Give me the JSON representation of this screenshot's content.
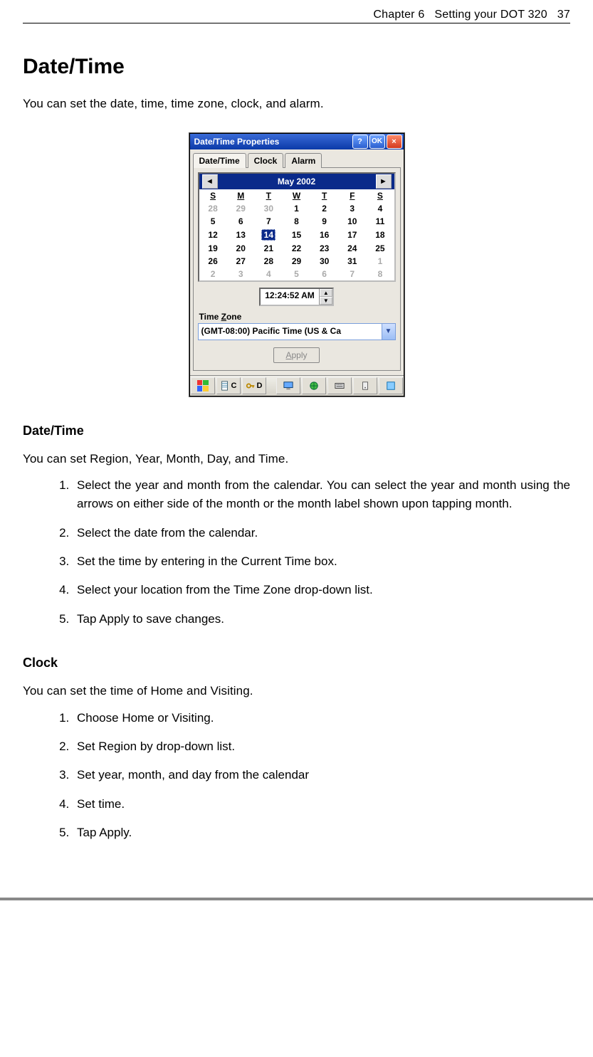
{
  "header": {
    "chapter": "Chapter 6",
    "title": "Setting your DOT 320",
    "page": "37"
  },
  "h1": "Date/Time",
  "intro": "You can set the date, time, time zone, clock, and alarm.",
  "dialog": {
    "title": "Date/Time Properties",
    "buttons": {
      "help": "?",
      "ok": "OK",
      "close": "×"
    },
    "tabs": [
      "Date/Time",
      "Clock",
      "Alarm"
    ],
    "calendar": {
      "month_label": "May 2002",
      "dow": [
        "S",
        "M",
        "T",
        "W",
        "T",
        "F",
        "S"
      ],
      "rows": [
        [
          {
            "d": "28",
            "dim": true
          },
          {
            "d": "29",
            "dim": true
          },
          {
            "d": "30",
            "dim": true
          },
          {
            "d": "1"
          },
          {
            "d": "2"
          },
          {
            "d": "3"
          },
          {
            "d": "4"
          }
        ],
        [
          {
            "d": "5"
          },
          {
            "d": "6"
          },
          {
            "d": "7"
          },
          {
            "d": "8"
          },
          {
            "d": "9"
          },
          {
            "d": "10"
          },
          {
            "d": "11"
          }
        ],
        [
          {
            "d": "12"
          },
          {
            "d": "13"
          },
          {
            "d": "14",
            "sel": true
          },
          {
            "d": "15"
          },
          {
            "d": "16"
          },
          {
            "d": "17"
          },
          {
            "d": "18"
          }
        ],
        [
          {
            "d": "19"
          },
          {
            "d": "20"
          },
          {
            "d": "21"
          },
          {
            "d": "22"
          },
          {
            "d": "23"
          },
          {
            "d": "24"
          },
          {
            "d": "25"
          }
        ],
        [
          {
            "d": "26"
          },
          {
            "d": "27"
          },
          {
            "d": "28"
          },
          {
            "d": "29"
          },
          {
            "d": "30"
          },
          {
            "d": "31"
          },
          {
            "d": "1",
            "dim": true
          }
        ],
        [
          {
            "d": "2",
            "dim": true
          },
          {
            "d": "3",
            "dim": true
          },
          {
            "d": "4",
            "dim": true
          },
          {
            "d": "5",
            "dim": true
          },
          {
            "d": "6",
            "dim": true
          },
          {
            "d": "7",
            "dim": true
          },
          {
            "d": "8",
            "dim": true
          }
        ]
      ]
    },
    "time_value": "12:24:52 AM",
    "tz_label_pre": "Time ",
    "tz_label_u": "Z",
    "tz_label_post": "one",
    "tz_value": "(GMT-08:00) Pacific Time (US & Ca",
    "apply_u": "A",
    "apply_post": "pply",
    "taskbar": {
      "c": "C",
      "d": "D"
    }
  },
  "sec_dt": {
    "heading": "Date/Time",
    "intro": "You can set Region, Year, Month, Day, and Time.",
    "steps": [
      "Select the year and month from the calendar. You can select the year and month using the arrows on either side of the month or the month label shown upon tapping month.",
      "Select the date from the calendar.",
      "Set the time by entering in the Current Time box.",
      "Select your location from the Time Zone drop-down list.",
      "Tap Apply to save changes."
    ]
  },
  "sec_clock": {
    "heading": "Clock",
    "intro": "You can set the time of Home and Visiting.",
    "steps": [
      "Choose Home or Visiting.",
      "Set Region by drop-down list.",
      "Set year, month, and day from the calendar",
      "Set time.",
      "Tap Apply."
    ]
  }
}
